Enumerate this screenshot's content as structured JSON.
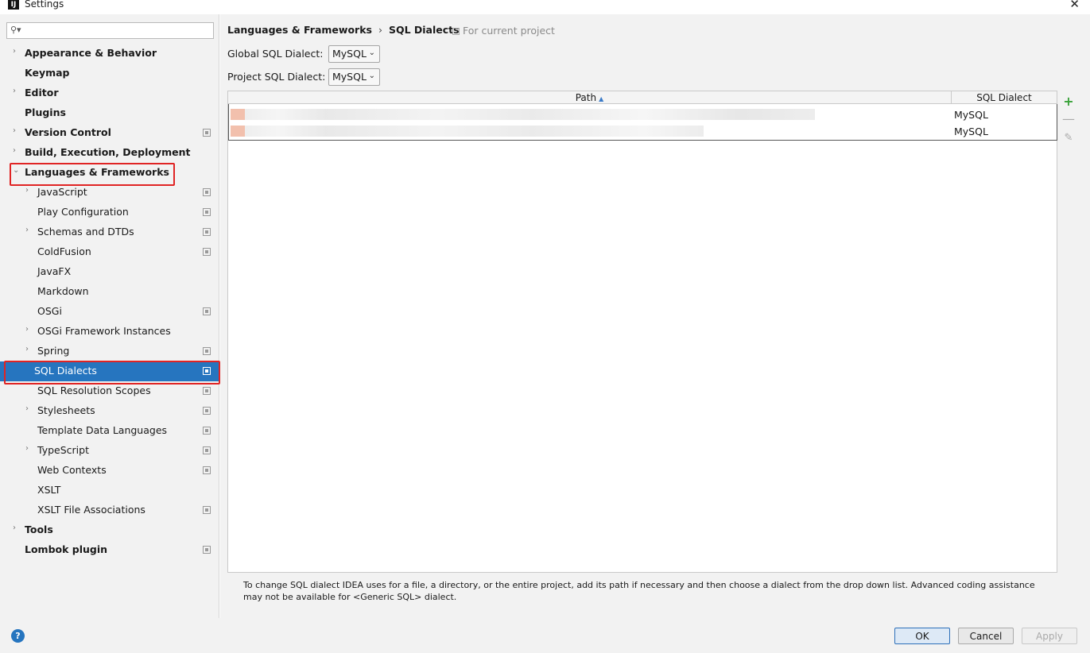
{
  "window": {
    "title": "Settings",
    "app_icon_text": "IJ",
    "close_glyph": "✕"
  },
  "search": {
    "placeholder": "",
    "icon": "search-icon"
  },
  "sidebar": {
    "items": [
      {
        "label": "Appearance & Behavior",
        "level": 0,
        "arrow": "›",
        "pj": false
      },
      {
        "label": "Keymap",
        "level": 0,
        "arrow": "",
        "pj": false
      },
      {
        "label": "Editor",
        "level": 0,
        "arrow": "›",
        "pj": false
      },
      {
        "label": "Plugins",
        "level": 0,
        "arrow": "",
        "pj": false
      },
      {
        "label": "Version Control",
        "level": 0,
        "arrow": "›",
        "pj": true
      },
      {
        "label": "Build, Execution, Deployment",
        "level": 0,
        "arrow": "›",
        "pj": false
      },
      {
        "label": "Languages & Frameworks",
        "level": 0,
        "arrow": "⌄",
        "pj": false
      },
      {
        "label": "JavaScript",
        "level": 1,
        "arrow": "›",
        "pj": true
      },
      {
        "label": "Play Configuration",
        "level": 1,
        "arrow": "",
        "pj": true
      },
      {
        "label": "Schemas and DTDs",
        "level": 1,
        "arrow": "›",
        "pj": true
      },
      {
        "label": "ColdFusion",
        "level": 1,
        "arrow": "",
        "pj": true
      },
      {
        "label": "JavaFX",
        "level": 1,
        "arrow": "",
        "pj": false
      },
      {
        "label": "Markdown",
        "level": 1,
        "arrow": "",
        "pj": false
      },
      {
        "label": "OSGi",
        "level": 1,
        "arrow": "",
        "pj": true
      },
      {
        "label": "OSGi Framework Instances",
        "level": 1,
        "arrow": "›",
        "pj": false
      },
      {
        "label": "Spring",
        "level": 1,
        "arrow": "›",
        "pj": true
      },
      {
        "label": "SQL Dialects",
        "level": 1,
        "arrow": "",
        "pj": true,
        "selected": true
      },
      {
        "label": "SQL Resolution Scopes",
        "level": 1,
        "arrow": "",
        "pj": true
      },
      {
        "label": "Stylesheets",
        "level": 1,
        "arrow": "›",
        "pj": true
      },
      {
        "label": "Template Data Languages",
        "level": 1,
        "arrow": "",
        "pj": true
      },
      {
        "label": "TypeScript",
        "level": 1,
        "arrow": "›",
        "pj": true
      },
      {
        "label": "Web Contexts",
        "level": 1,
        "arrow": "",
        "pj": true
      },
      {
        "label": "XSLT",
        "level": 1,
        "arrow": "",
        "pj": false
      },
      {
        "label": "XSLT File Associations",
        "level": 1,
        "arrow": "",
        "pj": true
      },
      {
        "label": "Tools",
        "level": 0,
        "arrow": "›",
        "pj": false
      },
      {
        "label": "Lombok plugin",
        "level": 0,
        "arrow": "",
        "pj": true
      }
    ]
  },
  "content": {
    "breadcrumb": {
      "parent": "Languages & Frameworks",
      "separator": "›",
      "current": "SQL Dialects"
    },
    "for_project": "For current project",
    "global_label": "Global SQL Dialect:",
    "global_value": "MySQL",
    "project_label": "Project SQL Dialect:",
    "project_value": "MySQL",
    "chevron": "⌄",
    "table": {
      "col_path": "Path",
      "sort_glyph": "▲",
      "col_dialect": "SQL Dialect",
      "rows": [
        {
          "dialect": "MySQL"
        },
        {
          "dialect": "MySQL"
        }
      ]
    },
    "tools": {
      "add": "+",
      "remove": "—",
      "edit": "✎"
    },
    "help_text": "To change SQL dialect IDEA uses for a file, a directory, or the entire project, add its path if necessary and then choose a dialect from the drop down list. Advanced coding assistance may not be available for <Generic SQL> dialect."
  },
  "footer": {
    "help_glyph": "?",
    "ok": "OK",
    "cancel": "Cancel",
    "apply": "Apply"
  },
  "colors": {
    "selection": "#2675bf",
    "highlight_box": "#e02424",
    "add_icon": "#3aa33a"
  }
}
